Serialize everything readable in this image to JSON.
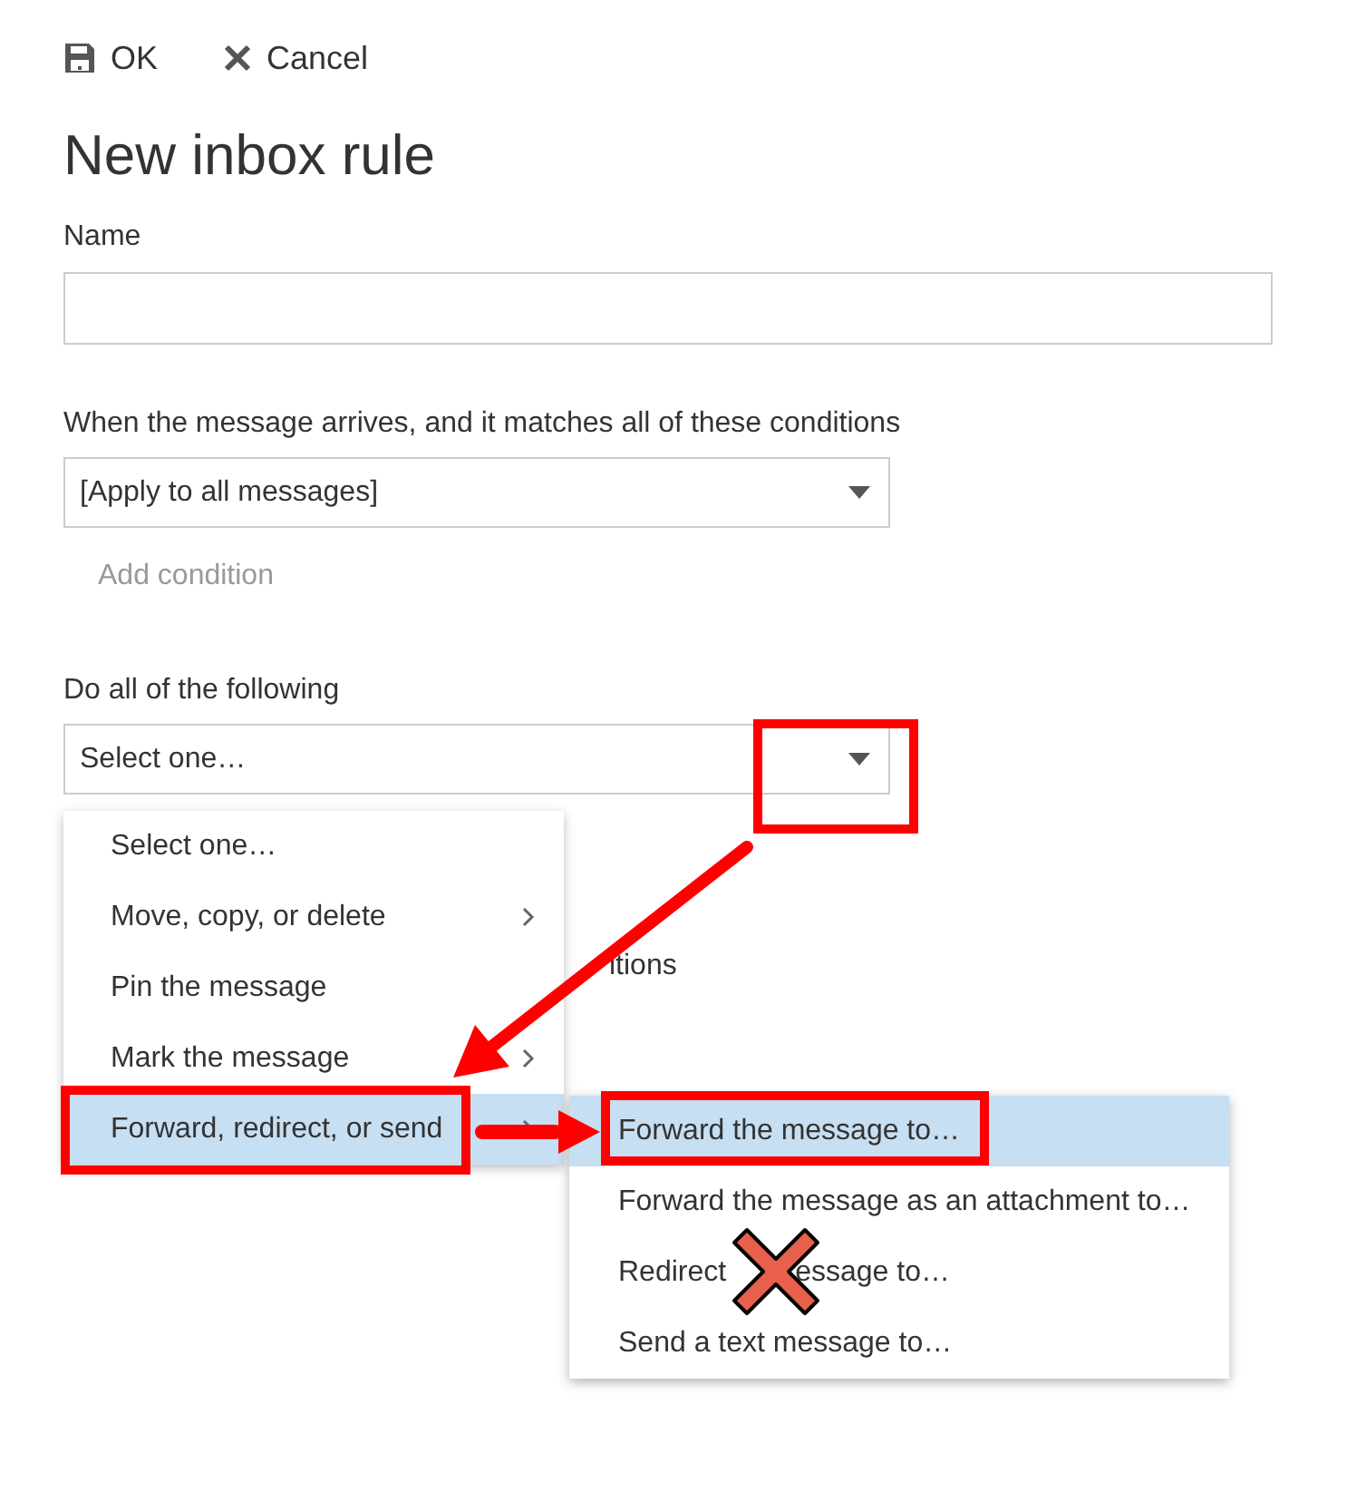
{
  "toolbar": [
    {
      "kind": "save",
      "label": "OK"
    },
    {
      "kind": "cancel",
      "label": "Cancel"
    }
  ],
  "title": "New inbox rule",
  "name_field": {
    "label": "Name"
  },
  "conditions": {
    "label": "When the message arrives, and it matches all of these conditions",
    "value": "[Apply to all messages]",
    "add_button": {
      "label": "Add condition",
      "disabled": true
    }
  },
  "actions": {
    "label": "Do all of the following",
    "value": "Select one…"
  },
  "partly_hidden_text": "itions",
  "menu": {
    "items": [
      {
        "label": "Select one…",
        "has_submenu": false,
        "selected": false
      },
      {
        "label": "Move, copy, or delete",
        "has_submenu": true,
        "selected": false
      },
      {
        "label": "Pin the message",
        "has_submenu": false,
        "selected": false
      },
      {
        "label": "Mark the message",
        "has_submenu": true,
        "selected": false
      },
      {
        "label": "Forward, redirect, or send",
        "has_submenu": true,
        "selected": true
      }
    ]
  },
  "submenu": {
    "items": [
      {
        "label": "Forward the message to…",
        "selected": true
      },
      {
        "label": "Forward the message as an attachment to…",
        "selected": false
      },
      {
        "visible_parts": [
          "Redirect",
          "essage to…"
        ],
        "selected": false
      },
      {
        "label": "Send a text message to…",
        "selected": false
      }
    ]
  }
}
